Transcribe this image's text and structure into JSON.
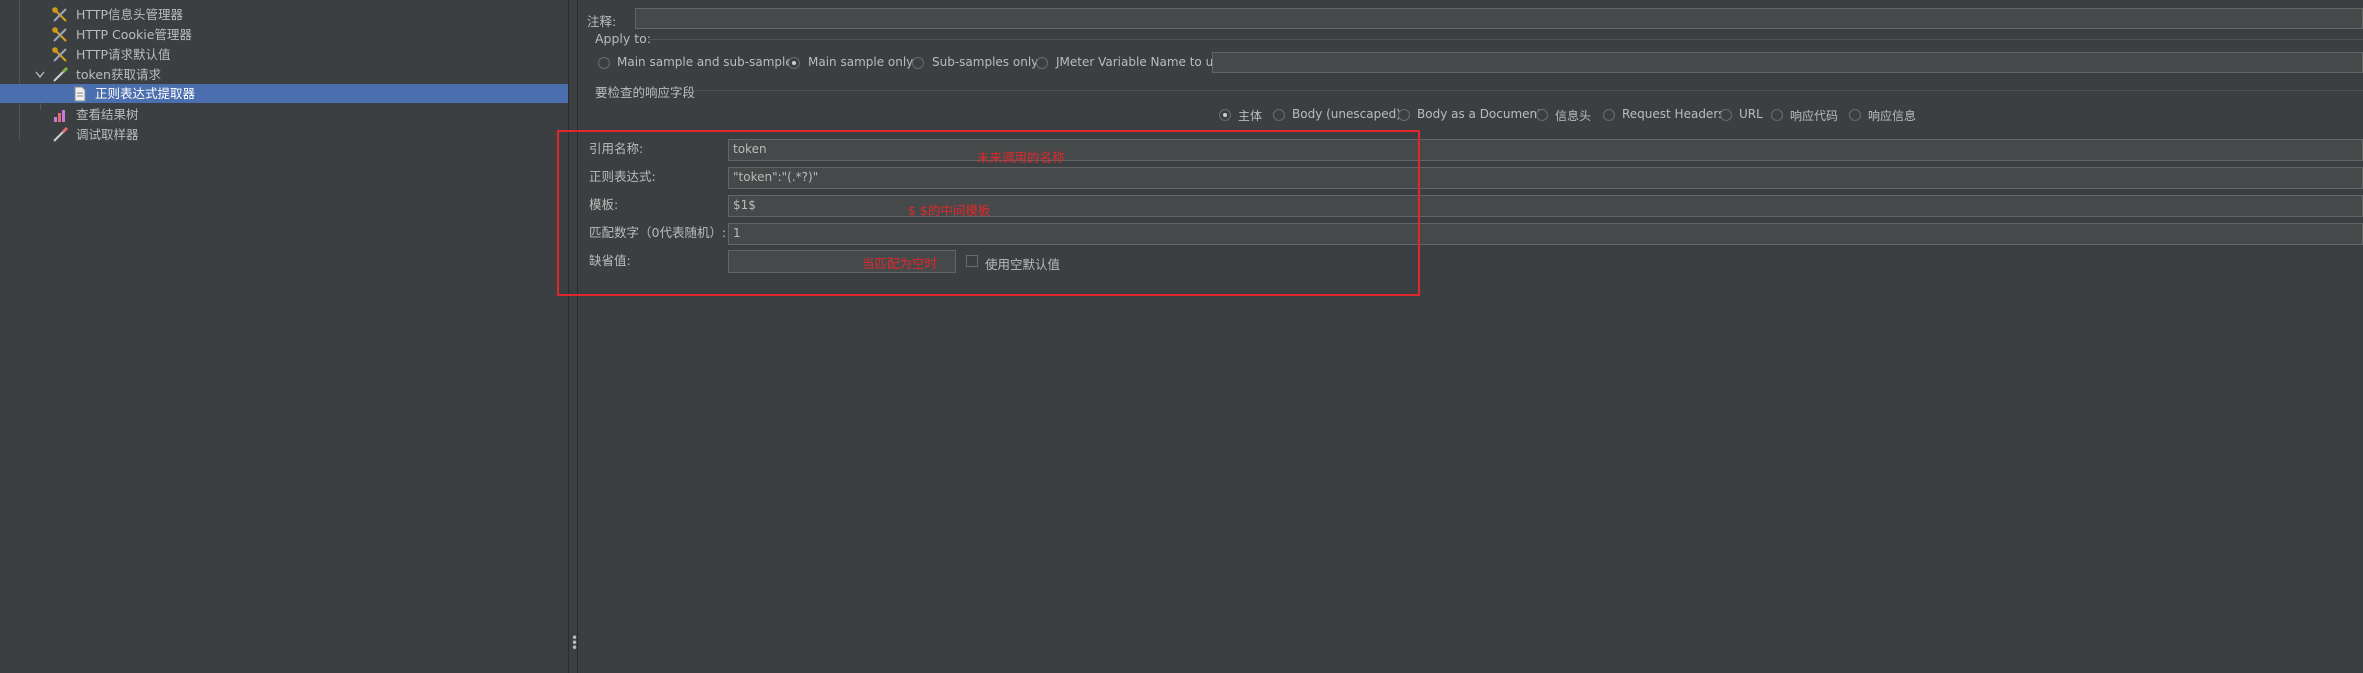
{
  "tree": {
    "items": [
      {
        "label": "HTTP信息头管理器",
        "icon": "wrench-icon"
      },
      {
        "label": "HTTP Cookie管理器",
        "icon": "wrench-icon"
      },
      {
        "label": "HTTP请求默认值",
        "icon": "wrench-icon"
      },
      {
        "label": "token获取请求",
        "icon": "pipette-icon",
        "expanded": true
      },
      {
        "label": "正则表达式提取器",
        "icon": "document-icon",
        "selected": true
      },
      {
        "label": "查看结果树",
        "icon": "chart-icon"
      },
      {
        "label": "调试取样器",
        "icon": "pipette-icon"
      }
    ]
  },
  "form": {
    "comment_label": "注释:",
    "comment_value": "",
    "apply_to": {
      "title": "Apply to:",
      "options": [
        "Main sample and sub-samples",
        "Main sample only",
        "Sub-samples only",
        "JMeter Variable Name to use"
      ],
      "selected": "Main sample only",
      "variable_value": ""
    },
    "field_to_check": {
      "title": "要检查的响应字段",
      "options": [
        "主体",
        "Body (unescaped)",
        "Body as a Document",
        "信息头",
        "Request Headers",
        "URL",
        "响应代码",
        "响应信息"
      ],
      "selected": "主体"
    },
    "ref_name_label": "引用名称:",
    "ref_name_value": "token",
    "regex_label": "正则表达式:",
    "regex_value": "\"token\":\"(.*?)\"",
    "template_label": "模板:",
    "template_value": "$1$",
    "match_no_label": "匹配数字（0代表随机）:",
    "match_no_value": "1",
    "default_label": "缺省值:",
    "default_value": "",
    "use_empty_default_label": "使用空默认值",
    "use_empty_default_checked": false
  },
  "annotations": {
    "ref_name_note": "未来调用的名称",
    "template_note": "$ $的中间模板",
    "default_note": "当匹配为空时"
  },
  "colors": {
    "background": "#3c3f41",
    "selection": "#4b6eaf",
    "annotation": "#e0282c"
  }
}
